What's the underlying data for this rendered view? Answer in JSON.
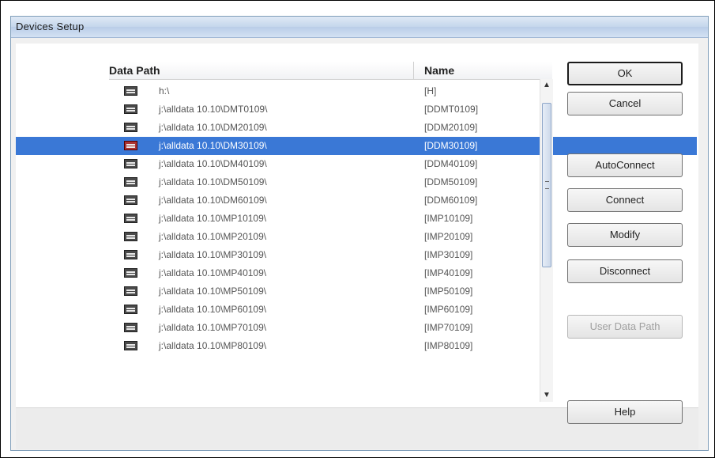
{
  "window": {
    "title": "Devices Setup"
  },
  "list": {
    "columns": [
      {
        "label": "Data Path"
      },
      {
        "label": "Name"
      }
    ],
    "selected_index": 3,
    "rows": [
      {
        "path": "h:\\",
        "name": "[H]"
      },
      {
        "path": "j:\\alldata 10.10\\DMT0109\\",
        "name": "[DDMT0109]"
      },
      {
        "path": "j:\\alldata 10.10\\DM20109\\",
        "name": "[DDM20109]"
      },
      {
        "path": "j:\\alldata 10.10\\DM30109\\",
        "name": "[DDM30109]"
      },
      {
        "path": "j:\\alldata 10.10\\DM40109\\",
        "name": "[DDM40109]"
      },
      {
        "path": "j:\\alldata 10.10\\DM50109\\",
        "name": "[DDM50109]"
      },
      {
        "path": "j:\\alldata 10.10\\DM60109\\",
        "name": "[DDM60109]"
      },
      {
        "path": "j:\\alldata 10.10\\MP10109\\",
        "name": "[IMP10109]"
      },
      {
        "path": "j:\\alldata 10.10\\MP20109\\",
        "name": "[IMP20109]"
      },
      {
        "path": "j:\\alldata 10.10\\MP30109\\",
        "name": "[IMP30109]"
      },
      {
        "path": "j:\\alldata 10.10\\MP40109\\",
        "name": "[IMP40109]"
      },
      {
        "path": "j:\\alldata 10.10\\MP50109\\",
        "name": "[IMP50109]"
      },
      {
        "path": "j:\\alldata 10.10\\MP60109\\",
        "name": "[IMP60109]"
      },
      {
        "path": "j:\\alldata 10.10\\MP70109\\",
        "name": "[IMP70109]"
      },
      {
        "path": "j:\\alldata 10.10\\MP80109\\",
        "name": "[IMP80109]"
      }
    ]
  },
  "buttons": {
    "ok": "OK",
    "cancel": "Cancel",
    "auto_connect": "AutoConnect",
    "connect": "Connect",
    "modify": "Modify",
    "disconnect": "Disconnect",
    "user_data_path": "User Data Path",
    "help": "Help"
  }
}
